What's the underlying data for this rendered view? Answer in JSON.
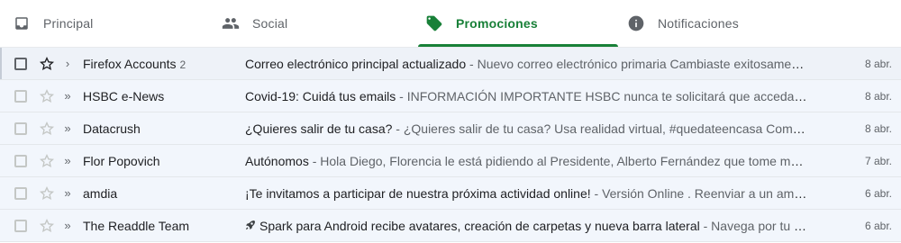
{
  "tabs": [
    {
      "label": "Principal",
      "icon": "inbox-icon"
    },
    {
      "label": "Social",
      "icon": "people-icon"
    },
    {
      "label": "Promociones",
      "icon": "tag-icon",
      "active": true
    },
    {
      "label": "Notificaciones",
      "icon": "info-icon"
    }
  ],
  "accent_color": "#188038",
  "emails": [
    {
      "sender": "Firefox Accounts",
      "count": "2",
      "subject": "Correo electrónico principal actualizado",
      "snippet": " - Nuevo correo electrónico primaria Cambiaste exitosamente tu ...",
      "date": "8 abr.",
      "icon": "",
      "importance": ""
    },
    {
      "sender": "HSBC e-News",
      "count": "",
      "subject": "Covid-19: Cuidá tus emails",
      "snippet": " - INFORMACIÓN IMPORTANTE HSBC nunca te solicitará que accedas a un sit...",
      "date": "8 abr.",
      "icon": "",
      "importance": "»"
    },
    {
      "sender": "Datacrush",
      "count": "",
      "subject": "¿Quieres salir de tu casa?",
      "snippet": " - ¿Quieres salir de tu casa? Usa realidad virtual, #quedateencasa Comprar Dar...",
      "date": "8 abr.",
      "icon": "",
      "importance": "»"
    },
    {
      "sender": "Flor Popovich",
      "count": "",
      "subject": "Autónomos",
      "snippet": " - Hola Diego, Florencia le está pidiendo al Presidente, Alberto Fernández que tome medidas ...",
      "date": "7 abr.",
      "icon": "",
      "importance": "»"
    },
    {
      "sender": "amdia",
      "count": "",
      "subject": "¡Te invitamos a participar de nuestra próxima actividad online!",
      "snippet": "  - Versión Online . Reenviar a un amigo *|...",
      "date": "6 abr.",
      "icon": "",
      "importance": "»"
    },
    {
      "sender": "The Readdle Team",
      "count": "",
      "subject": "Spark para Android recibe avatares, creación de carpetas y nueva barra lateral",
      "snippet": " - Navega por tu bandej...",
      "date": "6 abr.",
      "icon": "rocket-icon",
      "importance": "»"
    }
  ]
}
